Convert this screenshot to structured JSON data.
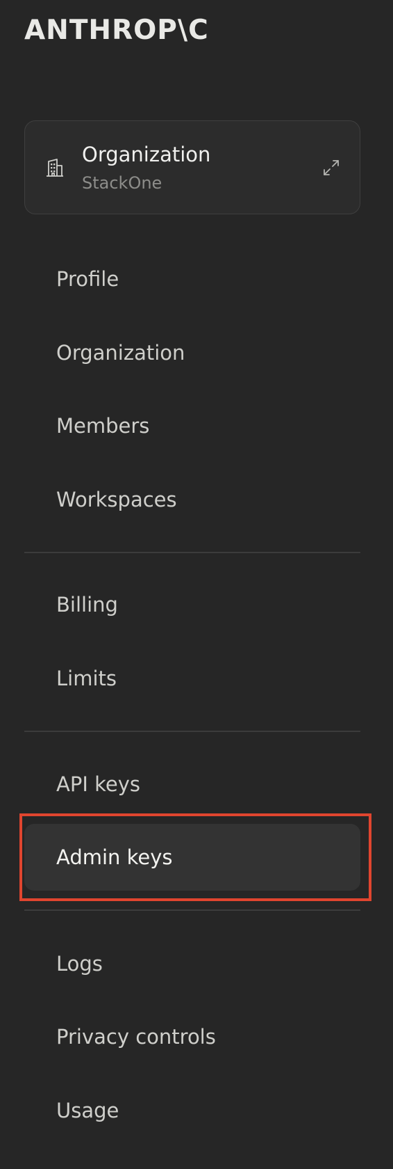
{
  "brand": {
    "logo_text": "ANTHROP\\C"
  },
  "org_switcher": {
    "title": "Organization",
    "subtitle": "StackOne",
    "icon": "building-icon",
    "expand_icon": "expand-arrows-icon"
  },
  "nav": {
    "group1": [
      "Profile",
      "Organization",
      "Members",
      "Workspaces"
    ],
    "group2": [
      "Billing",
      "Limits"
    ],
    "group3": [
      "API keys",
      "Admin keys"
    ],
    "group4": [
      "Logs",
      "Privacy controls",
      "Usage"
    ]
  },
  "active_item": "Admin keys",
  "colors": {
    "background": "#262626",
    "active_background": "#333333",
    "highlight_outline": "#e0452f"
  }
}
